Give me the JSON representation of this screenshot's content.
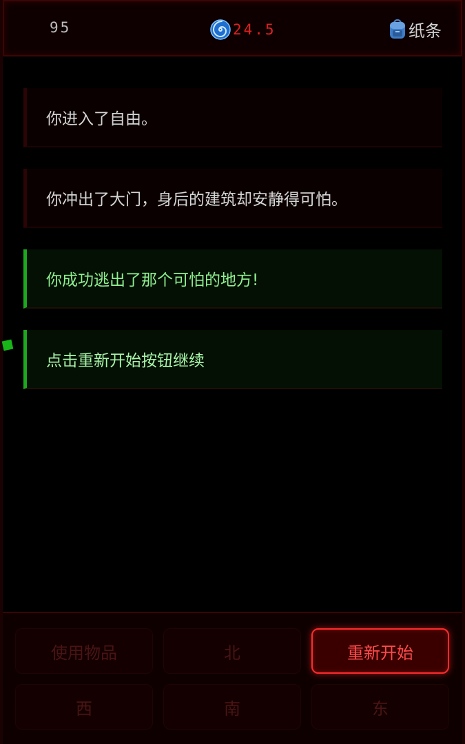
{
  "status": {
    "steps": "95",
    "sanity_icon": "spiral-icon",
    "sanity": "24.5",
    "inventory_icon": "backpack-icon",
    "inventory_label": "纸条"
  },
  "messages": [
    {
      "text": "你进入了自由。",
      "style": "normal"
    },
    {
      "text": "你冲出了大门，身后的建筑却安静得可怕。",
      "style": "normal"
    },
    {
      "text": "你成功逃出了那个可怕的地方!",
      "style": "success"
    },
    {
      "text": "点击重新开始按钮继续",
      "style": "success"
    }
  ],
  "controls": {
    "use_item": "使用物品",
    "north": "北",
    "restart": "重新开始",
    "west": "西",
    "south": "南",
    "east": "东"
  },
  "colors": {
    "accent_red": "#ff2b2b",
    "success_green": "#1ea81e"
  }
}
